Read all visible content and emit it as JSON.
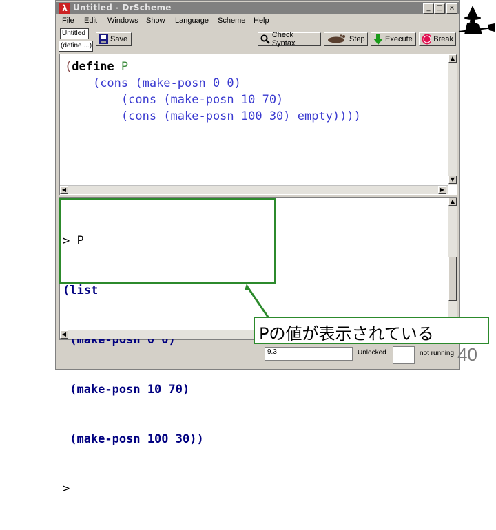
{
  "window": {
    "title": "Untitled - DrScheme",
    "logo_glyph": "λ",
    "controls": [
      "_",
      "□",
      "×"
    ]
  },
  "menu": [
    "File",
    "Edit",
    "Windows",
    "Show",
    "Language",
    "Scheme",
    "Help"
  ],
  "toolbar": {
    "name_box": "Untitled",
    "define_box": "(define ...)",
    "save_label": "Save",
    "check_syntax_label": "Check Syntax",
    "step_label": "Step",
    "execute_label": "Execute",
    "break_label": "Break"
  },
  "definitions": {
    "lines": [
      "(define P",
      "    (cons (make-posn 0 0)",
      "        (cons (make-posn 10 70)",
      "        (cons (make-posn 100 30) empty))))"
    ]
  },
  "interactions": {
    "prompt1": "> P",
    "output": [
      "(list",
      " (make-posn 0 0)",
      " (make-posn 10 70)",
      " (make-posn 100 30))"
    ],
    "prompt2": ">"
  },
  "status": {
    "position": "9.3",
    "lock": "Unlocked",
    "running": "not running"
  },
  "annotation": {
    "text": "Pの値が表示されている"
  },
  "slide_number": "40",
  "colors": {
    "annotation_green": "#2c8a2c",
    "keyword_blue": "#000080",
    "identifier_blue": "#3a3ad0"
  }
}
